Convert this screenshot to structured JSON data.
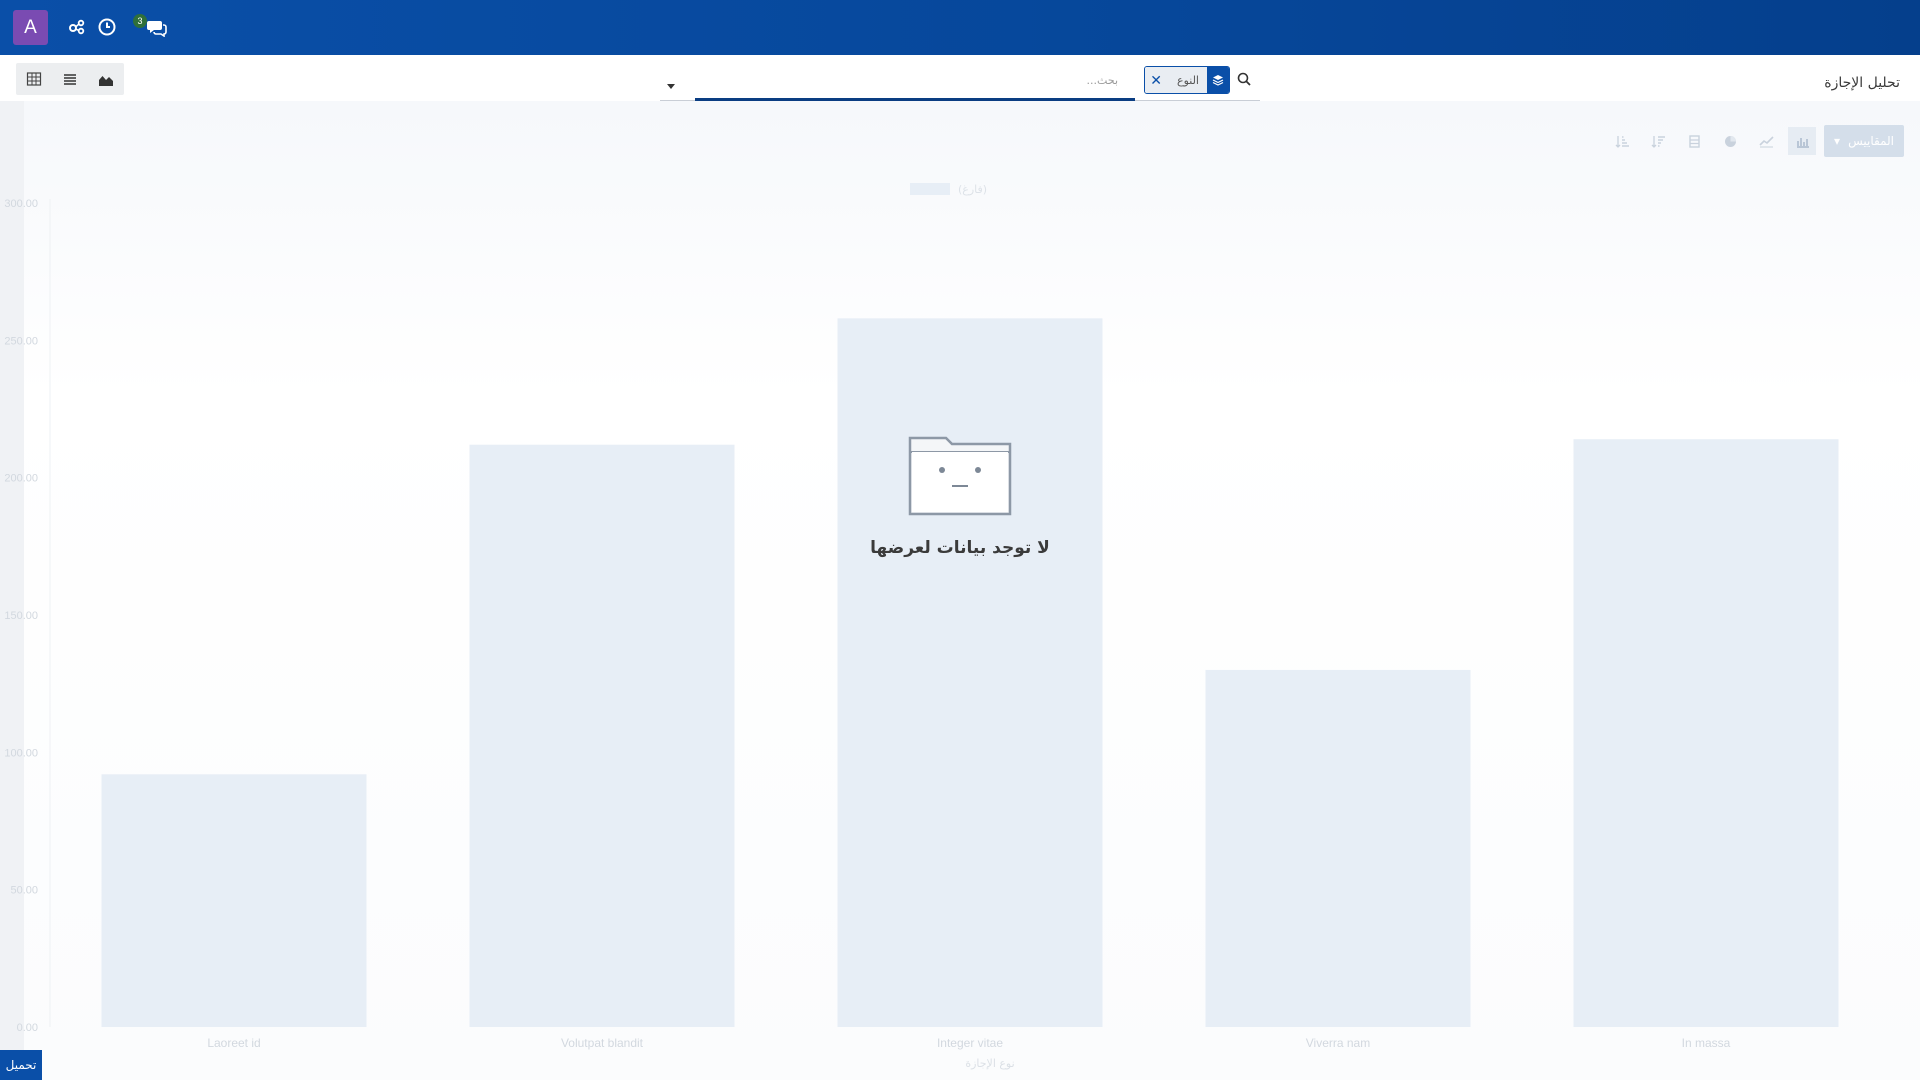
{
  "navbar": {
    "avatar_letter": "A",
    "messages_count": "3"
  },
  "control_panel": {
    "title": "تحليل الإجازة",
    "search": {
      "facet_value": "النوع",
      "placeholder": "بحث..."
    },
    "views": [
      "graph",
      "list",
      "pivot"
    ]
  },
  "graph_toolbar": {
    "measures_label": "المقاييس"
  },
  "empty_state": {
    "message": "لا توجد بيانات لعرضها"
  },
  "download_label": "تحميل",
  "chart_data": {
    "type": "bar",
    "categories": [
      "Laoreet id",
      "Volutpat blandit",
      "Integer vitae",
      "Viverra nam",
      "In massa"
    ],
    "values": [
      92,
      212,
      258,
      130,
      214
    ],
    "xlabel": "نوع الإجازة",
    "ylabel": "",
    "legend": [
      "(فارغ)"
    ],
    "ylim": [
      0,
      300
    ],
    "yticks": [
      "0.00",
      "50.00",
      "100.00",
      "150.00",
      "200.00",
      "250.00",
      "300.00"
    ],
    "grid": false
  },
  "colors": {
    "navbar": "#0a4fa8",
    "accent": "#0a4fa8",
    "bar_faded": "#e7eef6"
  }
}
